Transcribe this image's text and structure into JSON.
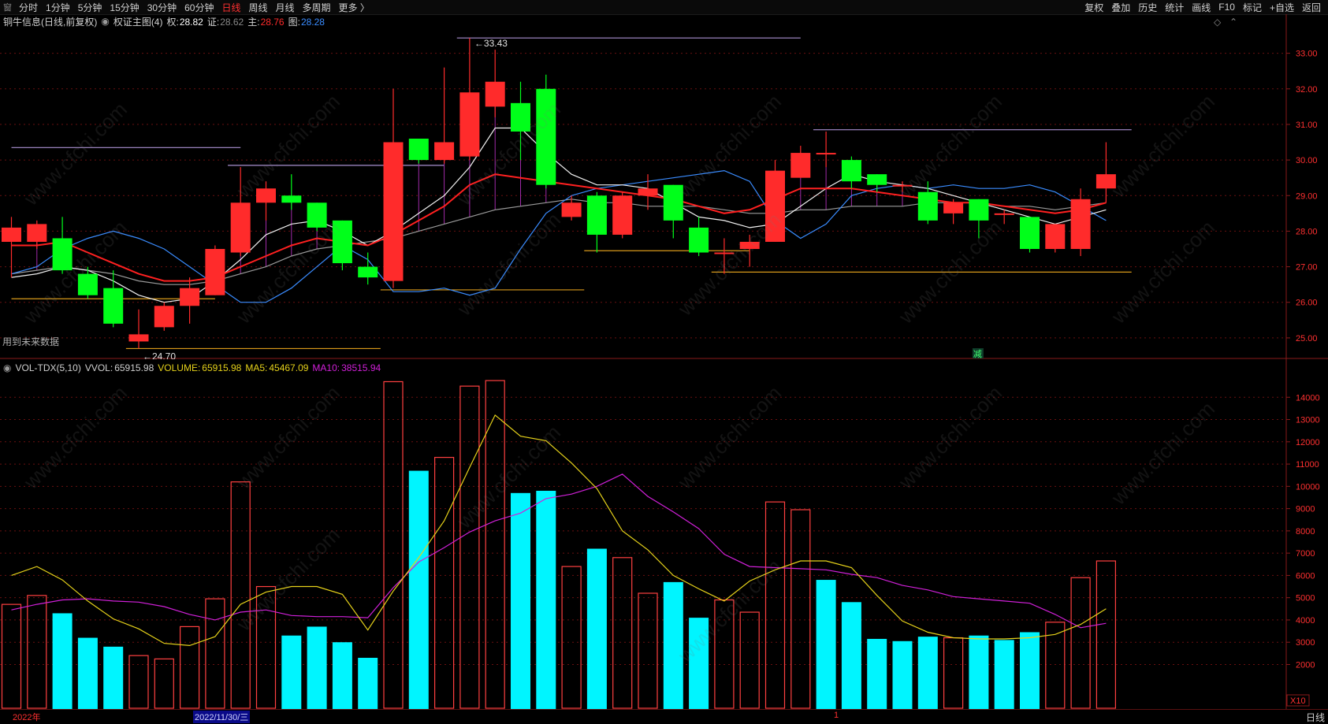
{
  "toolbar": {
    "system_icon": "窗",
    "periods": [
      "分时",
      "1分钟",
      "5分钟",
      "15分钟",
      "30分钟",
      "60分钟",
      "日线",
      "周线",
      "月线",
      "多周期",
      "更多 〉"
    ],
    "active_period": "日线",
    "right_buttons": [
      "复权",
      "叠加",
      "历史",
      "统计",
      "画线",
      "F10",
      "标记",
      "+自选",
      "返回"
    ]
  },
  "main_info": {
    "stock_title": "铜牛信息(日线,前复权)",
    "indicator_name": "权证主图(4)",
    "items": [
      {
        "label": "权:",
        "value": "28.82",
        "color": "#ffffff"
      },
      {
        "label": "证:",
        "value": "28.62",
        "color": "#888888"
      },
      {
        "label": "主:",
        "value": "28.76",
        "color": "#ff2b2b"
      },
      {
        "label": "图:",
        "value": "28.28",
        "color": "#3a8cff"
      }
    ],
    "future_data_note": "用到未来数据",
    "high_marker": "33.43",
    "low_marker": "24.70",
    "signal_text": "减"
  },
  "price_axis": {
    "min": 24.4,
    "max": 33.7,
    "ticks": [
      "33.00",
      "32.00",
      "31.00",
      "30.00",
      "29.00",
      "28.00",
      "27.00",
      "26.00",
      "25.00"
    ]
  },
  "candles": [
    {
      "o": 27.7,
      "c": 28.1,
      "h": 28.4,
      "l": 26.7
    },
    {
      "o": 27.7,
      "c": 28.2,
      "h": 28.3,
      "l": 27.5
    },
    {
      "o": 27.8,
      "c": 26.9,
      "h": 28.4,
      "l": 26.8
    },
    {
      "o": 26.8,
      "c": 26.2,
      "h": 27.0,
      "l": 26.1
    },
    {
      "o": 26.4,
      "c": 25.4,
      "h": 26.9,
      "l": 25.3
    },
    {
      "o": 24.9,
      "c": 25.1,
      "h": 25.8,
      "l": 24.7
    },
    {
      "o": 25.3,
      "c": 25.9,
      "h": 26.0,
      "l": 25.2
    },
    {
      "o": 25.9,
      "c": 26.4,
      "h": 26.7,
      "l": 25.4
    },
    {
      "o": 26.2,
      "c": 27.5,
      "h": 27.6,
      "l": 26.2
    },
    {
      "o": 27.4,
      "c": 28.8,
      "h": 29.8,
      "l": 27.3
    },
    {
      "o": 28.8,
      "c": 29.2,
      "h": 29.4,
      "l": 28.3
    },
    {
      "o": 29.0,
      "c": 28.8,
      "h": 29.6,
      "l": 28.6
    },
    {
      "o": 28.8,
      "c": 28.1,
      "h": 28.8,
      "l": 28.0
    },
    {
      "o": 28.3,
      "c": 27.1,
      "h": 28.3,
      "l": 26.9
    },
    {
      "o": 27.0,
      "c": 26.7,
      "h": 27.4,
      "l": 26.5
    },
    {
      "o": 26.6,
      "c": 30.5,
      "h": 32.0,
      "l": 26.4
    },
    {
      "o": 30.6,
      "c": 30.0,
      "h": 30.6,
      "l": 29.9
    },
    {
      "o": 30.0,
      "c": 30.5,
      "h": 32.6,
      "l": 29.9
    },
    {
      "o": 30.1,
      "c": 31.9,
      "h": 33.43,
      "l": 30.0
    },
    {
      "o": 31.5,
      "c": 32.2,
      "h": 33.1,
      "l": 31.2
    },
    {
      "o": 31.6,
      "c": 30.8,
      "h": 32.2,
      "l": 30.0
    },
    {
      "o": 32.0,
      "c": 29.3,
      "h": 32.4,
      "l": 29.2
    },
    {
      "o": 28.4,
      "c": 28.8,
      "h": 29.0,
      "l": 28.3
    },
    {
      "o": 29.0,
      "c": 27.9,
      "h": 29.1,
      "l": 27.4
    },
    {
      "o": 27.9,
      "c": 29.0,
      "h": 29.1,
      "l": 27.8
    },
    {
      "o": 29.0,
      "c": 29.2,
      "h": 29.6,
      "l": 28.6
    },
    {
      "o": 29.3,
      "c": 28.3,
      "h": 29.3,
      "l": 27.8
    },
    {
      "o": 28.1,
      "c": 27.4,
      "h": 28.4,
      "l": 27.3
    },
    {
      "o": 27.4,
      "c": 27.4,
      "h": 27.8,
      "l": 26.8
    },
    {
      "o": 27.5,
      "c": 27.7,
      "h": 27.9,
      "l": 27.0
    },
    {
      "o": 27.7,
      "c": 29.7,
      "h": 30.0,
      "l": 27.7
    },
    {
      "o": 29.5,
      "c": 30.2,
      "h": 30.4,
      "l": 29.5
    },
    {
      "o": 30.2,
      "c": 30.2,
      "h": 30.8,
      "l": 29.8
    },
    {
      "o": 30.0,
      "c": 29.4,
      "h": 30.1,
      "l": 29.2
    },
    {
      "o": 29.6,
      "c": 29.3,
      "h": 29.6,
      "l": 29.1
    },
    {
      "o": 29.3,
      "c": 29.3,
      "h": 29.4,
      "l": 29.1
    },
    {
      "o": 29.1,
      "c": 28.3,
      "h": 29.4,
      "l": 28.2
    },
    {
      "o": 28.5,
      "c": 28.8,
      "h": 28.9,
      "l": 28.2
    },
    {
      "o": 28.9,
      "c": 28.3,
      "h": 28.9,
      "l": 27.8
    },
    {
      "o": 28.5,
      "c": 28.5,
      "h": 28.6,
      "l": 28.2
    },
    {
      "o": 28.4,
      "c": 27.5,
      "h": 28.4,
      "l": 27.4
    },
    {
      "o": 27.5,
      "c": 28.2,
      "h": 28.2,
      "l": 27.4
    },
    {
      "o": 27.5,
      "c": 28.9,
      "h": 29.2,
      "l": 27.3
    },
    {
      "o": 29.2,
      "c": 29.6,
      "h": 30.5,
      "l": 28.8
    }
  ],
  "ma_lines": {
    "white": [
      26.7,
      26.8,
      27.0,
      26.9,
      26.6,
      26.2,
      26.0,
      26.1,
      26.6,
      27.2,
      27.9,
      28.2,
      28.3,
      28.0,
      27.6,
      28.0,
      28.5,
      29.0,
      29.8,
      30.9,
      30.9,
      30.2,
      29.6,
      29.3,
      29.3,
      29.2,
      28.8,
      28.4,
      28.3,
      28.1,
      28.2,
      28.7,
      29.2,
      29.6,
      29.4,
      29.3,
      29.2,
      29.0,
      28.8,
      28.6,
      28.4,
      28.2,
      28.4,
      28.6
    ],
    "red": [
      27.6,
      27.6,
      27.7,
      27.4,
      27.1,
      26.8,
      26.6,
      26.6,
      26.7,
      27.0,
      27.3,
      27.6,
      27.8,
      27.7,
      27.6,
      27.9,
      28.3,
      28.7,
      29.3,
      29.6,
      29.5,
      29.4,
      29.3,
      29.2,
      29.1,
      29.0,
      28.9,
      28.7,
      28.5,
      28.6,
      28.9,
      29.2,
      29.2,
      29.2,
      29.1,
      29.0,
      28.9,
      28.8,
      28.8,
      28.7,
      28.6,
      28.5,
      28.6,
      28.8
    ],
    "gray": [
      26.8,
      26.9,
      27.0,
      26.9,
      26.8,
      26.6,
      26.5,
      26.5,
      26.6,
      26.8,
      27.0,
      27.3,
      27.5,
      27.6,
      27.7,
      27.8,
      28.0,
      28.2,
      28.4,
      28.6,
      28.7,
      28.8,
      28.9,
      28.8,
      28.8,
      28.7,
      28.7,
      28.7,
      28.6,
      28.5,
      28.5,
      28.6,
      28.6,
      28.7,
      28.7,
      28.7,
      28.8,
      28.8,
      28.8,
      28.7,
      28.7,
      28.6,
      28.7,
      28.8
    ],
    "blue": [
      26.8,
      27.0,
      27.5,
      27.8,
      28.0,
      27.8,
      27.5,
      27.0,
      26.5,
      26.0,
      26.0,
      26.4,
      27.0,
      27.6,
      27.2,
      26.3,
      26.3,
      26.4,
      26.2,
      26.4,
      27.5,
      28.5,
      29.0,
      29.2,
      29.3,
      29.4,
      29.5,
      29.6,
      29.7,
      29.4,
      28.3,
      27.8,
      28.2,
      29.0,
      29.2,
      29.3,
      29.2,
      29.3,
      29.2,
      29.2,
      29.3,
      29.1,
      28.7,
      28.3
    ]
  },
  "support_lines": [
    {
      "from": 0,
      "to": 9,
      "price": 30.35,
      "color": "#a98fd0"
    },
    {
      "from": 8.5,
      "to": 17,
      "price": 29.85,
      "color": "#a98fd0"
    },
    {
      "from": 17.5,
      "to": 31,
      "price": 33.43,
      "color": "#a98fd0"
    },
    {
      "from": 31.5,
      "to": 44,
      "price": 30.85,
      "color": "#a98fd0"
    },
    {
      "from": 0,
      "to": 8,
      "price": 26.1,
      "color": "#d99a1a"
    },
    {
      "from": 4.5,
      "to": 14.5,
      "price": 24.7,
      "color": "#d99a1a"
    },
    {
      "from": 14.5,
      "to": 22.5,
      "price": 26.35,
      "color": "#d99a1a"
    },
    {
      "from": 22.5,
      "to": 29,
      "price": 27.45,
      "color": "#d99a1a"
    },
    {
      "from": 27.5,
      "to": 44,
      "price": 26.85,
      "color": "#d99a1a"
    }
  ],
  "vol_info": {
    "indicator": "VOL-TDX(5,10)",
    "vvol_label": "VVOL:",
    "vvol_value": "65915.98",
    "volume_label": "VOLUME:",
    "volume_value": "65915.98",
    "ma5_label": "MA5:",
    "ma5_value": "45467.09",
    "ma10_label": "MA10:",
    "ma10_value": "38515.94"
  },
  "volume_axis": {
    "min": 0,
    "max": 15000,
    "unit": "X10",
    "ticks": [
      "14000",
      "13000",
      "12000",
      "11000",
      "10000",
      "9000",
      "8000",
      "7000",
      "6000",
      "5000",
      "4000",
      "3000",
      "2000"
    ]
  },
  "volumes": [
    {
      "v": 4700,
      "up": true
    },
    {
      "v": 5100,
      "up": true
    },
    {
      "v": 4300,
      "up": false
    },
    {
      "v": 3200,
      "up": false
    },
    {
      "v": 2800,
      "up": false
    },
    {
      "v": 2400,
      "up": true
    },
    {
      "v": 2250,
      "up": true
    },
    {
      "v": 3700,
      "up": true
    },
    {
      "v": 4950,
      "up": true
    },
    {
      "v": 10200,
      "up": true
    },
    {
      "v": 5500,
      "up": true
    },
    {
      "v": 3300,
      "up": false
    },
    {
      "v": 3700,
      "up": false
    },
    {
      "v": 3000,
      "up": false
    },
    {
      "v": 2300,
      "up": false
    },
    {
      "v": 14700,
      "up": true
    },
    {
      "v": 10700,
      "up": false
    },
    {
      "v": 11300,
      "up": true
    },
    {
      "v": 14500,
      "up": true
    },
    {
      "v": 14750,
      "up": true
    },
    {
      "v": 9700,
      "up": false
    },
    {
      "v": 9800,
      "up": false
    },
    {
      "v": 6400,
      "up": true
    },
    {
      "v": 7200,
      "up": false
    },
    {
      "v": 6800,
      "up": true
    },
    {
      "v": 5200,
      "up": true
    },
    {
      "v": 5700,
      "up": false
    },
    {
      "v": 4100,
      "up": false
    },
    {
      "v": 4900,
      "up": true
    },
    {
      "v": 4350,
      "up": true
    },
    {
      "v": 9300,
      "up": true
    },
    {
      "v": 8950,
      "up": true
    },
    {
      "v": 5800,
      "up": false
    },
    {
      "v": 4800,
      "up": false
    },
    {
      "v": 3150,
      "up": false
    },
    {
      "v": 3050,
      "up": false
    },
    {
      "v": 3250,
      "up": false
    },
    {
      "v": 3200,
      "up": true
    },
    {
      "v": 3300,
      "up": false
    },
    {
      "v": 3100,
      "up": false
    },
    {
      "v": 3450,
      "up": false
    },
    {
      "v": 3900,
      "up": true
    },
    {
      "v": 5900,
      "up": true
    },
    {
      "v": 6650,
      "up": true
    }
  ],
  "vol_ma5": [
    6000,
    6400,
    5800,
    4850,
    4050,
    3600,
    2950,
    2850,
    3250,
    4700,
    5250,
    5500,
    5500,
    5150,
    3550,
    5300,
    6800,
    8450,
    10850,
    13200,
    12250,
    12050,
    11050,
    9900,
    8000,
    7150,
    6000,
    5400,
    4850,
    5750,
    6250,
    6650,
    6650,
    6350,
    5100,
    3950,
    3450,
    3200,
    3150,
    3150,
    3200,
    3350,
    3800,
    4500
  ],
  "vol_ma10": [
    4450,
    4700,
    4900,
    4950,
    4850,
    4800,
    4600,
    4250,
    4000,
    4350,
    4450,
    4200,
    4150,
    4150,
    4100,
    5450,
    6600,
    7250,
    7950,
    8450,
    8800,
    9450,
    9650,
    10000,
    10550,
    9550,
    8850,
    8100,
    6950,
    6400,
    6350,
    6300,
    6250,
    6050,
    5900,
    5550,
    5350,
    5050,
    4950,
    4850,
    4750,
    4250,
    3650,
    3850
  ],
  "time_axis": {
    "start_label": "2022年",
    "cursor_date": "2022/11/30/三",
    "mark": "1",
    "right_label": "日线"
  },
  "watermark": "www.cfchi.com",
  "colors": {
    "up": "#ff2b2b",
    "down": "#00ff1a",
    "vol_down": "#00f5ff",
    "vol_up_border": "#ff4040",
    "ma5": "#e6d21a",
    "ma10": "#d020d8",
    "grid": "#6a1010"
  }
}
